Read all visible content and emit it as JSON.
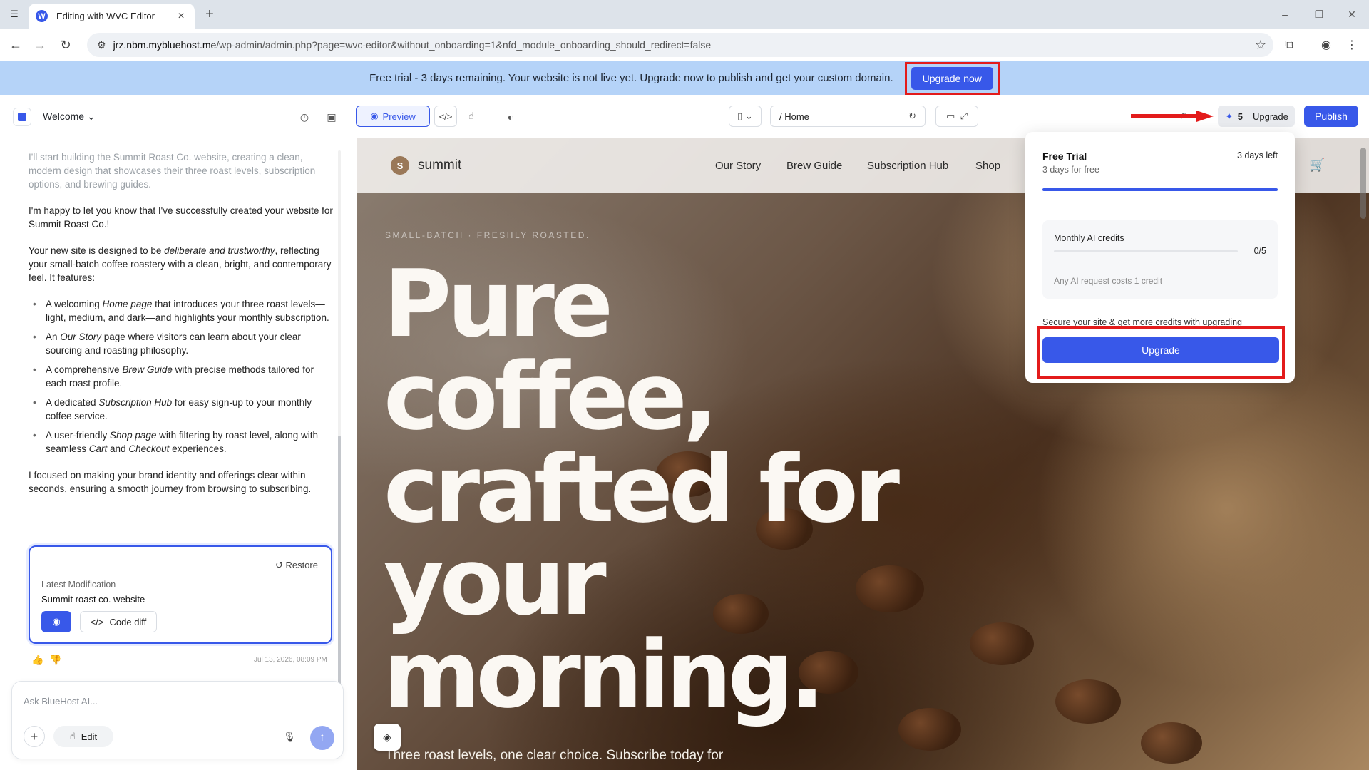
{
  "browser": {
    "tab_title": "Editing with WVC Editor",
    "favicon_letter": "W",
    "url_host": "jrz.nbm.mybluehost.me",
    "url_path": "/wp-admin/admin.php?page=wvc-editor&without_onboarding=1&nfd_module_onboarding_should_redirect=false"
  },
  "banner": {
    "text": "Free trial - 3 days remaining. Your website is not live yet. Upgrade now to publish and get your custom domain.",
    "button": "Upgrade now"
  },
  "editor_header": {
    "welcome": "Welcome",
    "preview": "Preview",
    "page_path": "/ Home",
    "credits_count": "5",
    "upgrade": "Upgrade",
    "publish": "Publish"
  },
  "chat": {
    "intro_faded": "I'll start building the Summit Roast Co. website, creating a clean, modern design that showcases their three roast levels, subscription options, and brewing guides.",
    "p1": "I'm happy to let you know that I've successfully created your website for Summit Roast Co.!",
    "p2_a": "Your new site is designed to be ",
    "p2_em": "deliberate and trustworthy",
    "p2_b": ", reflecting your small-batch coffee roastery with a clean, bright, and contemporary feel. It features:",
    "bullets": [
      {
        "a": "A welcoming ",
        "em": "Home page",
        "b": " that introduces your three roast levels—light, medium, and dark—and highlights your monthly subscription."
      },
      {
        "a": "An ",
        "em": "Our Story",
        "b": " page where visitors can learn about your clear sourcing and roasting philosophy."
      },
      {
        "a": "A comprehensive ",
        "em": "Brew Guide",
        "b": " with precise methods tailored for each roast profile."
      },
      {
        "a": "A dedicated ",
        "em": "Subscription Hub",
        "b": " for easy sign-up to your monthly coffee service."
      },
      {
        "a": "A user-friendly ",
        "em": "Shop page",
        "b": " with filtering by roast level, along with seamless ",
        "em2": "Cart",
        "c": " and ",
        "em3": "Checkout",
        "d": " experiences."
      }
    ],
    "p3": "I focused on making your brand identity and offerings clear within seconds, ensuring a smooth journey from browsing to subscribing.",
    "mod_card": {
      "restore": "Restore",
      "label": "Latest Modification",
      "value": "Summit roast co. website",
      "code_diff": "Code diff"
    },
    "timestamp": "Jul 13, 2026, 08:09 PM",
    "input_placeholder": "Ask BlueHost AI...",
    "edit": "Edit"
  },
  "site": {
    "logo_letter": "S",
    "logo": "summit",
    "nav": [
      "Our Story",
      "Brew Guide",
      "Subscription Hub",
      "Shop"
    ],
    "eyebrow": "SMALL-BATCH · FRESHLY ROASTED.",
    "hero_lines": [
      "Pure",
      "coffee,",
      "crafted for",
      "your",
      "morning."
    ],
    "subtitle": "Three roast levels, one clear choice. Subscribe today for"
  },
  "popover": {
    "title": "Free Trial",
    "subtitle": "3 days for free",
    "days_left": "3 days left",
    "trial_progress": 1.0,
    "credits_label": "Monthly AI credits",
    "credits_value": "0/5",
    "credits_fraction": 0,
    "credits_note": "Any AI request costs 1 credit",
    "secure_text": "Secure your site & get more credits with upgrading",
    "upgrade_button": "Upgrade"
  },
  "colors": {
    "accent": "#3858e9",
    "banner": "#b5d3f8",
    "highlight_red": "#e31b1b"
  }
}
